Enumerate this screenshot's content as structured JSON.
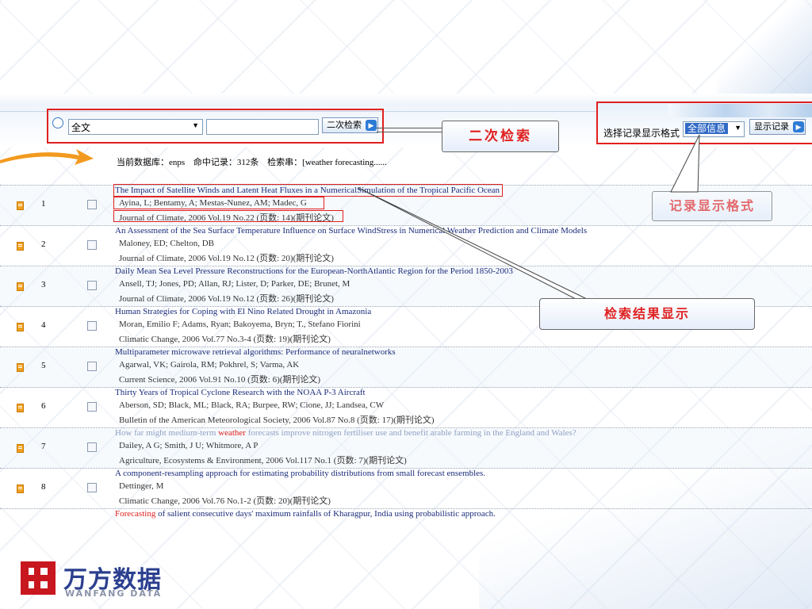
{
  "search": {
    "field_value": "全文",
    "query_value": "",
    "secondary_search_label": "二次检索"
  },
  "format": {
    "label": "选择记录显示格式",
    "selected": "全部信息",
    "show_button_label": "显示记录"
  },
  "callouts": {
    "secondary_search": "二次检索",
    "record_format": "记录显示格式",
    "results_display": "检索结果显示"
  },
  "db_info": {
    "database": "当前数据库：enps",
    "hits": "命中记录：312条",
    "query": "检索串：[weather forecasting......"
  },
  "results": [
    {
      "num": "1",
      "title": "The Impact of Satellite Winds and Latent Heat Fluxes in a NumericalSimulation of the Tropical Pacific Ocean",
      "authors": "Ayina, L; Bentamy, A; Mestas-Nunez, AM; Madec, G",
      "journal": "Journal of Climate, 2006 Vol.19 No.22 (页数: 14)(期刊论文)"
    },
    {
      "num": "2",
      "title": "An Assessment of the Sea Surface Temperature Influence on Surface WindStress in Numerical Weather Prediction and Climate Models",
      "authors": "Maloney, ED; Chelton, DB",
      "journal": "Journal of Climate, 2006 Vol.19 No.12 (页数: 20)(期刊论文)"
    },
    {
      "num": "3",
      "title": "Daily Mean Sea Level Pressure Reconstructions for the European-NorthAtlantic Region for the Period 1850-2003",
      "authors": "Ansell, TJ; Jones, PD; Allan, RJ; Lister, D; Parker, DE; Brunet, M",
      "journal": "Journal of Climate, 2006 Vol.19 No.12 (页数: 26)(期刊论文)"
    },
    {
      "num": "4",
      "title": "Human Strategies for Coping with El Nino Related Drought in Amazonia",
      "authors": "Moran, Emilio F; Adams, Ryan; Bakoyema, Bryn; T., Stefano Fiorini",
      "journal": "Climatic Change, 2006 Vol.77 No.3-4 (页数: 19)(期刊论文)"
    },
    {
      "num": "5",
      "title": "Multiparameter microwave retrieval algorithms: Performance of neuralnetworks",
      "authors": "Agarwal, VK; Gairola, RM; Pokhrel, S; Varma, AK",
      "journal": "Current Science, 2006 Vol.91 No.10 (页数: 6)(期刊论文)"
    },
    {
      "num": "6",
      "title": "Thirty Years of Tropical Cyclone Research with the NOAA P-3 Aircraft",
      "authors": "Aberson, SD; Black, ML; Black, RA; Burpee, RW; Cione, JJ; Landsea, CW",
      "journal": "Bulletin of the American Meteorological Society, 2006 Vol.87 No.8 (页数: 17)(期刊论文)"
    },
    {
      "num": "7",
      "title_pre": "How far might medium-term ",
      "title_hl": "weather",
      "title_post": " forecasts improve nitrogen fertiliser use and benefit arable farming in the England and Wales?",
      "authors": "Dailey, A G; Smith, J U; Whitmore, A P",
      "journal": "Agriculture, Ecosystems & Environment, 2006 Vol.117 No.1 (页数: 7)(期刊论文)"
    },
    {
      "num": "8",
      "title": "A component-resampling approach for estimating probability distributions from small forecast ensembles.",
      "authors": "Dettinger, M",
      "journal": "Climatic Change, 2006 Vol.76 No.1-2 (页数: 20)(期刊论文)"
    }
  ],
  "last_title_hl": "Forecasting",
  "last_title_post": " of salient consecutive days' maximum rainfalls of Kharagpur, India using probabilistic approach.",
  "logo": {
    "cn": "万方数据",
    "en": "WANFANG DATA"
  },
  "colors": {
    "annotation_red": "#e02020",
    "title_blue": "#1a2c7a",
    "brand_navy": "#2b3f8f",
    "brand_red": "#c8171e"
  }
}
